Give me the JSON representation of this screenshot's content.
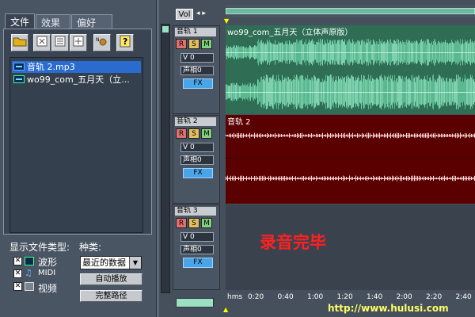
{
  "organizer": {
    "tabs": [
      "文件",
      "效果",
      "偏好"
    ],
    "files": [
      "音轨  2.mp3",
      "wo99_com_五月天（立..."
    ],
    "show_type_label": "显示文件类型:",
    "type_label": "种类:",
    "filters": [
      {
        "label": "波形",
        "checked": "✕"
      },
      {
        "label": "MIDI",
        "checked": "✕"
      },
      {
        "label": "视频",
        "checked": "✕"
      }
    ],
    "sort_value": "最近的数据",
    "auto_play_label": "自动播放",
    "full_path_label": "完整路径"
  },
  "header": {
    "vol_label": "Vol"
  },
  "tracks": [
    {
      "name": "音轨 1",
      "wave_title": "wo99_com_五月天（立体声原版）",
      "volume": "V 0",
      "pan": "声相0",
      "fx": "FX",
      "wave_color": "#3a8a6a",
      "bg": "#2f6e55"
    },
    {
      "name": "音轨 2",
      "wave_title": "音轨 2",
      "volume": "V 0",
      "pan": "声相0",
      "fx": "FX",
      "wave_color": "#ffd6d6",
      "bg": "#5a0000"
    },
    {
      "name": "音轨 3",
      "wave_title": "",
      "volume": "V 0",
      "pan": "声相0",
      "fx": "FX",
      "wave_color": "",
      "bg": "#3a424e"
    }
  ],
  "rsm": [
    "R",
    "S",
    "M"
  ],
  "timeline": [
    "hms",
    "0:20",
    "0:40",
    "1:00",
    "1:20",
    "1:40",
    "2:00",
    "2:20",
    "2:40"
  ],
  "overlay_text": "录音完毕",
  "watermark": "http://www.hulusi.com"
}
